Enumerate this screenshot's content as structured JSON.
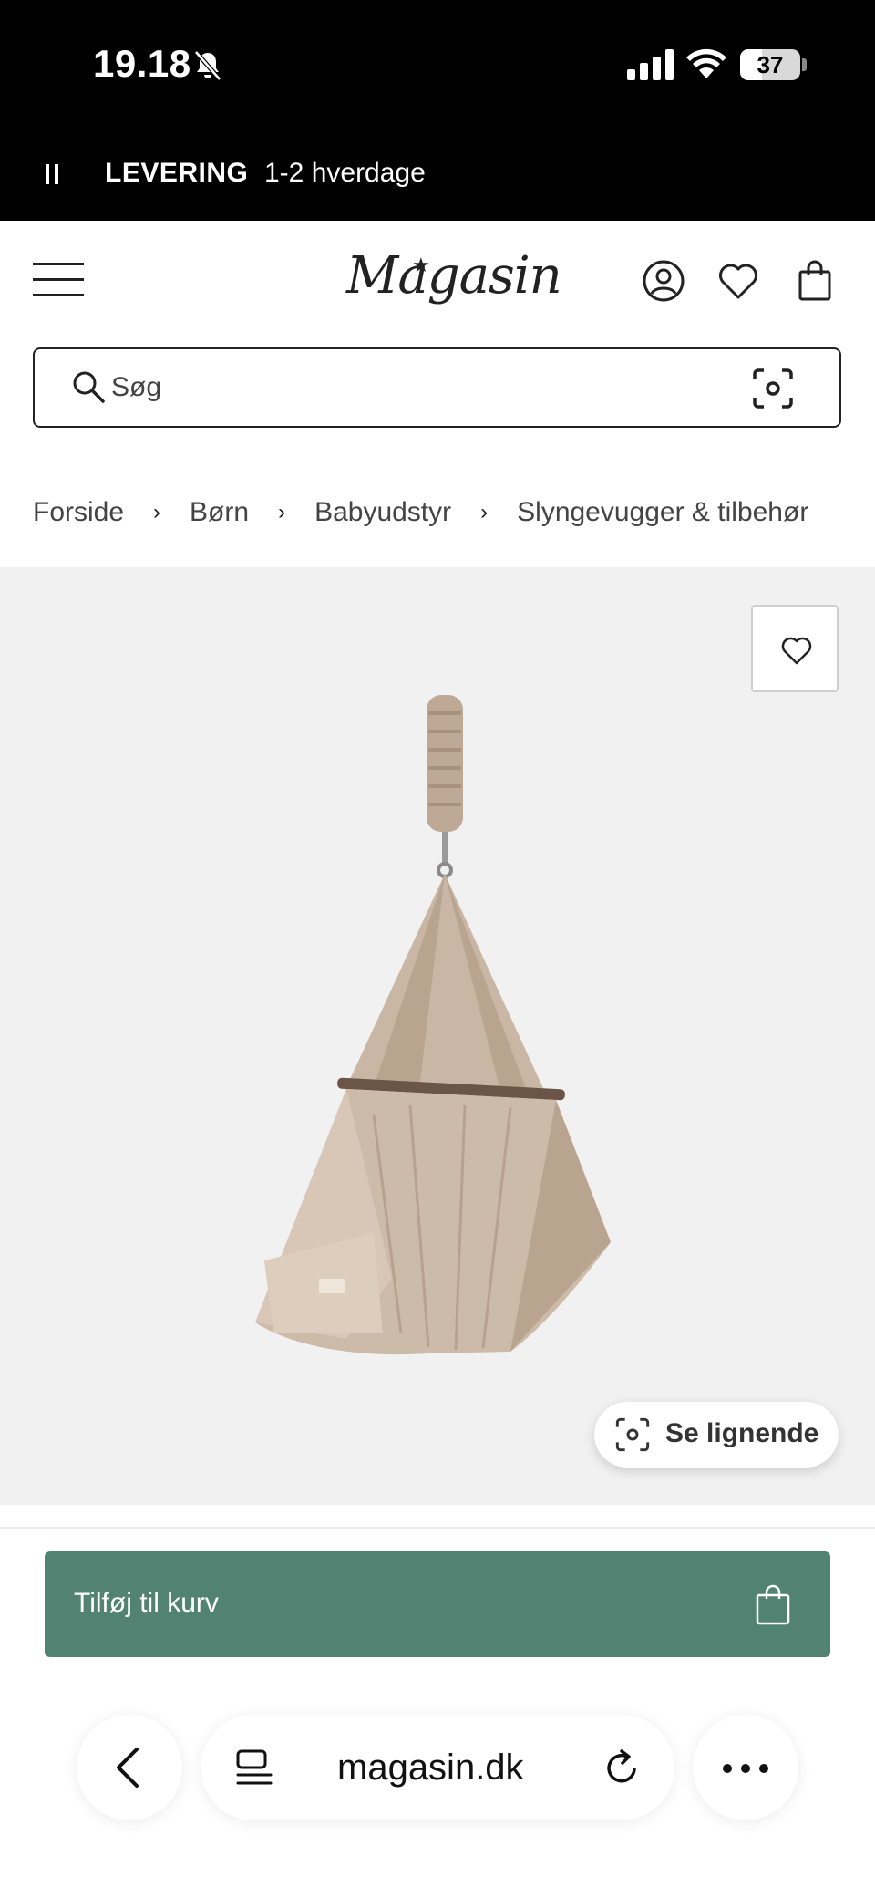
{
  "status_bar": {
    "time": "19.18",
    "battery": "37",
    "battery_level": 0.37,
    "icons": [
      "bell-slash-icon",
      "signal-icon",
      "wifi-icon",
      "battery-icon"
    ]
  },
  "delivery": {
    "label": "LEVERING",
    "value": "1-2 hverdage",
    "pause_icon": "pause-icon"
  },
  "header": {
    "logo": "Magasin",
    "icons": [
      "menu-icon",
      "account-icon",
      "heart-icon",
      "shopping-bag-icon"
    ]
  },
  "search": {
    "placeholder": "Søg",
    "icons": [
      "search-icon",
      "camera-scan-icon"
    ]
  },
  "breadcrumb": {
    "items": [
      "Forside",
      "Børn",
      "Babyudstyr",
      "Slyngevugger & tilbehør"
    ],
    "separator": "›"
  },
  "product": {
    "favorite_icon": "heart-icon",
    "similar_label": "Se lignende",
    "similar_icon": "camera-scan-icon",
    "image_colors": {
      "fabric": "#c9b6a4",
      "fabric_shadow": "#a8927d",
      "background": "#f1f1f1",
      "bar": "#6b5547"
    }
  },
  "cart": {
    "add_label": "Tilføj til kurv",
    "icon": "shopping-bag-icon",
    "button_color": "#528372"
  },
  "browser": {
    "url": "magasin.dk",
    "icons": [
      "back-icon",
      "tabs-icon",
      "reload-icon",
      "more-icon"
    ]
  }
}
